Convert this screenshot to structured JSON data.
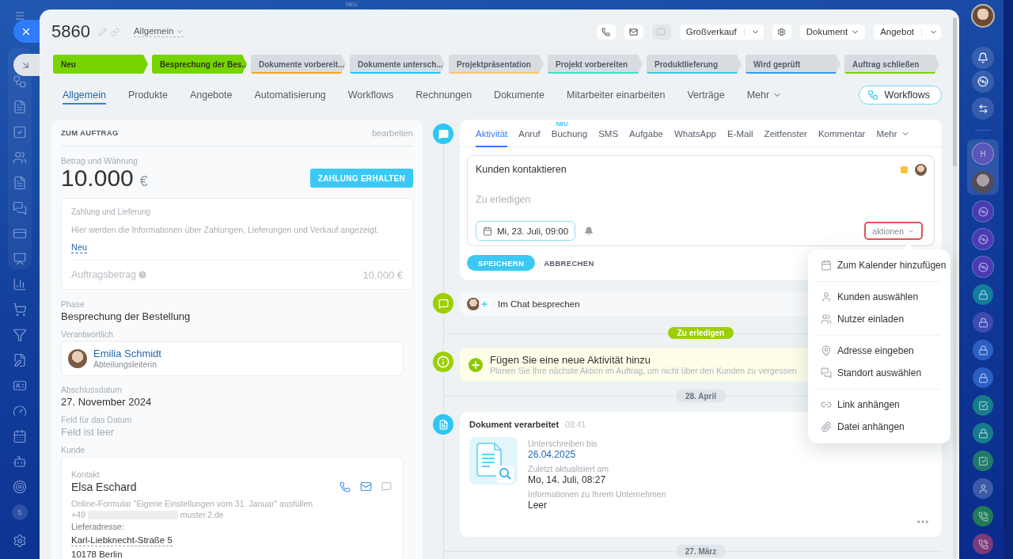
{
  "background": {
    "badge": "NEU"
  },
  "left_sidebar": {
    "avatar_letter": "S"
  },
  "header": {
    "title": "5860",
    "category": "Allgemein",
    "toolbar": [
      {
        "kind": "icon",
        "disabled": false
      },
      {
        "kind": "icon",
        "disabled": false
      },
      {
        "kind": "icon",
        "disabled": true
      },
      {
        "kind": "split",
        "label": "Großverkauf"
      },
      {
        "kind": "icon",
        "disabled": false
      },
      {
        "kind": "dropdown",
        "label": "Dokument"
      },
      {
        "kind": "split",
        "label": "Angebot"
      }
    ]
  },
  "stages": [
    {
      "label": "Neu",
      "completed": true,
      "color": "#76d500"
    },
    {
      "label": "Besprechung der Bes...",
      "completed": true,
      "color": "#76d500"
    },
    {
      "label": "Dokumente vorbereit...",
      "completed": false,
      "color": "#f7a21b"
    },
    {
      "label": "Dokumente untersch...",
      "completed": false,
      "color": "#1ec6fa"
    },
    {
      "label": "Projektpräsentation",
      "completed": false,
      "color": "#fbc56a"
    },
    {
      "label": "Projekt vorbereiten",
      "completed": false,
      "color": "#3ee0c6"
    },
    {
      "label": "Produktlieferung",
      "completed": false,
      "color": "#39cbe8"
    },
    {
      "label": "Wird geprüft",
      "completed": false,
      "color": "#2f9cf0"
    },
    {
      "label": "Auftrag schließen",
      "completed": false,
      "color": "#7bd500"
    }
  ],
  "tabs": [
    {
      "label": "Allgemein",
      "selected": true,
      "kind": "tab"
    },
    {
      "label": "Produkte",
      "selected": false,
      "kind": "tab"
    },
    {
      "label": "Angebote",
      "selected": false,
      "kind": "tab"
    },
    {
      "label": "Automatisierung",
      "selected": false,
      "kind": "tab"
    },
    {
      "label": "Workflows",
      "selected": false,
      "kind": "tab"
    },
    {
      "label": "Rechnungen",
      "selected": false,
      "kind": "tab"
    },
    {
      "label": "Dokumente",
      "selected": false,
      "kind": "tab"
    },
    {
      "label": "Mitarbeiter einarbeiten",
      "selected": false,
      "kind": "tab"
    },
    {
      "label": "Verträge",
      "selected": false,
      "kind": "tab"
    },
    {
      "label": "Mehr",
      "selected": false,
      "kind": "menu"
    }
  ],
  "workflows_button": "Workflows",
  "order": {
    "title": "ZUM AUFTRAG",
    "edit_link": "bearbeiten",
    "amount_label": "Betrag und Währung",
    "amount": "10.000",
    "currency": "€",
    "pay_button": "ZAHLUNG ERHALTEN",
    "payment": {
      "title": "Zahlung und Lieferung",
      "description": "Hier werden die Informationen über Zahlungen, Lieferungen und Verkauf angezeigt.",
      "new_link": "Neu",
      "total_label": "Auftragsbetrag",
      "total": "10.000 €"
    },
    "fields": [
      {
        "kind": "text",
        "label": "Phase",
        "value": "Besprechung der Bestellung"
      },
      {
        "kind": "user",
        "label": "Verantwortlich",
        "name": "Emilia Schmidt",
        "position": "Abteilungsleiterin"
      },
      {
        "kind": "text",
        "label": "Abschlussdatum",
        "value": "27. November 2024"
      },
      {
        "kind": "empty",
        "label": "Feld für das Datum",
        "value": "Feld ist leer"
      },
      {
        "kind": "client",
        "label": "Kunde",
        "type_label": "Kontakt",
        "name": "Elsa Eschard",
        "source": "Online-Formular \"Eigene Einstellungen vom 31. Januar\" ausfüllen",
        "phone": "+49",
        "email": "muster.2.de",
        "address_label": "Lieferadresse:",
        "address_lines": [
          "Karl-Liebknecht-Straße 5",
          "10178 Berlin"
        ]
      }
    ]
  },
  "activity": {
    "tabs": [
      {
        "label": "Aktivität",
        "selected": true,
        "kind": "tab"
      },
      {
        "label": "Anruf",
        "selected": false,
        "kind": "tab"
      },
      {
        "label": "Buchung",
        "selected": false,
        "kind": "tab",
        "badge": "NEU"
      },
      {
        "label": "SMS",
        "selected": false,
        "kind": "tab"
      },
      {
        "label": "Aufgabe",
        "selected": false,
        "kind": "tab"
      },
      {
        "label": "WhatsApp",
        "selected": false,
        "kind": "tab"
      },
      {
        "label": "E-Mail",
        "selected": false,
        "kind": "tab"
      },
      {
        "label": "Zeitfenster",
        "selected": false,
        "kind": "tab"
      },
      {
        "label": "Kommentar",
        "selected": false,
        "kind": "tab"
      },
      {
        "label": "Mehr",
        "selected": false,
        "kind": "menu"
      }
    ],
    "editor": {
      "title": "Kunden kontaktieren",
      "color": "#f9c23c",
      "placeholder": "Zu erledigen",
      "date": "Mi, 23. Juli, 09:00",
      "actions_button": "aktionen",
      "actions_highlighted": true
    },
    "save_button": "SPEICHERN",
    "cancel_button": "ABBRECHEN"
  },
  "actions_menu": {
    "sections": [
      {
        "items": [
          "Zum Kalender hinzufügen"
        ]
      },
      {
        "items": [
          "Kunden auswählen",
          "Nutzer einladen"
        ]
      },
      {
        "items": [
          "Adresse eingeben",
          "Standort auswählen"
        ]
      },
      {
        "items": [
          "Link anhängen",
          "Datei anhängen"
        ]
      }
    ]
  },
  "timeline": [
    {
      "kind": "chat",
      "label": "Im Chat besprechen"
    },
    {
      "kind": "status",
      "label": "Zu erledigen"
    },
    {
      "kind": "hint",
      "title": "Fügen Sie eine neue Aktivität hinzu",
      "text": "Planen Sie Ihre nächste Aktion im Auftrag, um nicht über den Kunden zu vergessen"
    },
    {
      "kind": "date",
      "label": "28. April"
    },
    {
      "kind": "document",
      "title": "Dokument verarbeitet",
      "time": "08:41",
      "fields": [
        {
          "label": "Unterschreiben bis",
          "value": "26.04.2025",
          "kind": "link"
        },
        {
          "label": "Zuletzt aktualisiert am",
          "value": "Mo, 14. Juli, 08:27",
          "kind": "text"
        },
        {
          "label": "Informationen zu Ihrem Unternehmen",
          "value": "Leer",
          "kind": "text"
        }
      ]
    },
    {
      "kind": "date",
      "label": "27. März"
    }
  ],
  "right_sidebar": {
    "group_letter": "H"
  }
}
